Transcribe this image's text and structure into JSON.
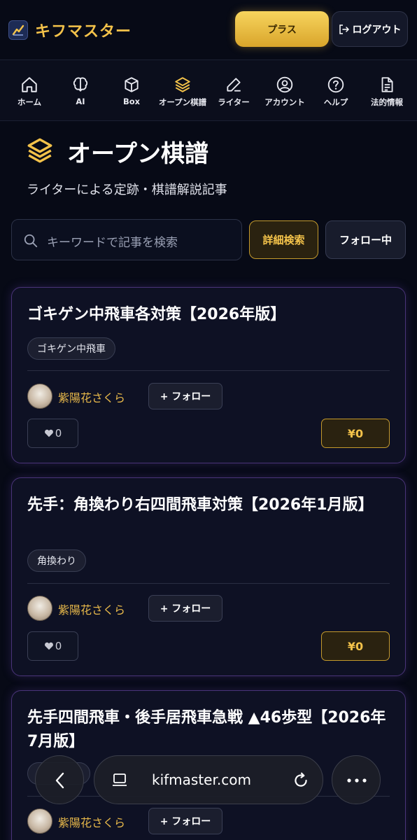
{
  "header": {
    "app_name": "キフマスター",
    "plus_label": "プラス",
    "logout_label": "ログアウト"
  },
  "nav": {
    "items": [
      {
        "label": "ホーム",
        "icon": "home-icon"
      },
      {
        "label": "AI",
        "icon": "brain-icon"
      },
      {
        "label": "Box",
        "icon": "box-icon"
      },
      {
        "label": "オープン棋譜",
        "icon": "layers-icon",
        "active": true
      },
      {
        "label": "ライター",
        "icon": "pen-icon"
      },
      {
        "label": "アカウント",
        "icon": "user-circle-icon"
      },
      {
        "label": "ヘルプ",
        "icon": "help-icon"
      },
      {
        "label": "法的情報",
        "icon": "document-icon"
      }
    ]
  },
  "page": {
    "title": "オープン棋譜",
    "subtitle": "ライターによる定跡・棋譜解説記事"
  },
  "search": {
    "placeholder": "キーワードで記事を検索",
    "detail_label": "詳細検索",
    "following_label": "フォロー中"
  },
  "articles": [
    {
      "title": "ゴキゲン中飛車各対策【2026年版】",
      "tag": "ゴキゲン中飛車",
      "author": "紫陽花さくら",
      "follow_label": "+ フォロー",
      "likes": "0",
      "price": "¥0"
    },
    {
      "title": "先手：角換わり右四間飛車対策【2026年1月版】",
      "tag": "角換わり",
      "author": "紫陽花さくら",
      "follow_label": "+ フォロー",
      "likes": "0",
      "price": "¥0"
    },
    {
      "title": "先手四間飛車・後手居飛車急戦 ▲46歩型【2026年7月版】",
      "tag": "",
      "author": "紫陽花さくら",
      "follow_label": "+ フォロー",
      "likes": "",
      "price": ""
    }
  ],
  "browser": {
    "url": "kifmaster.com"
  },
  "colors": {
    "background": "#070a16",
    "accent_gold": "#f3c24a",
    "card_border": "#4a3479"
  }
}
